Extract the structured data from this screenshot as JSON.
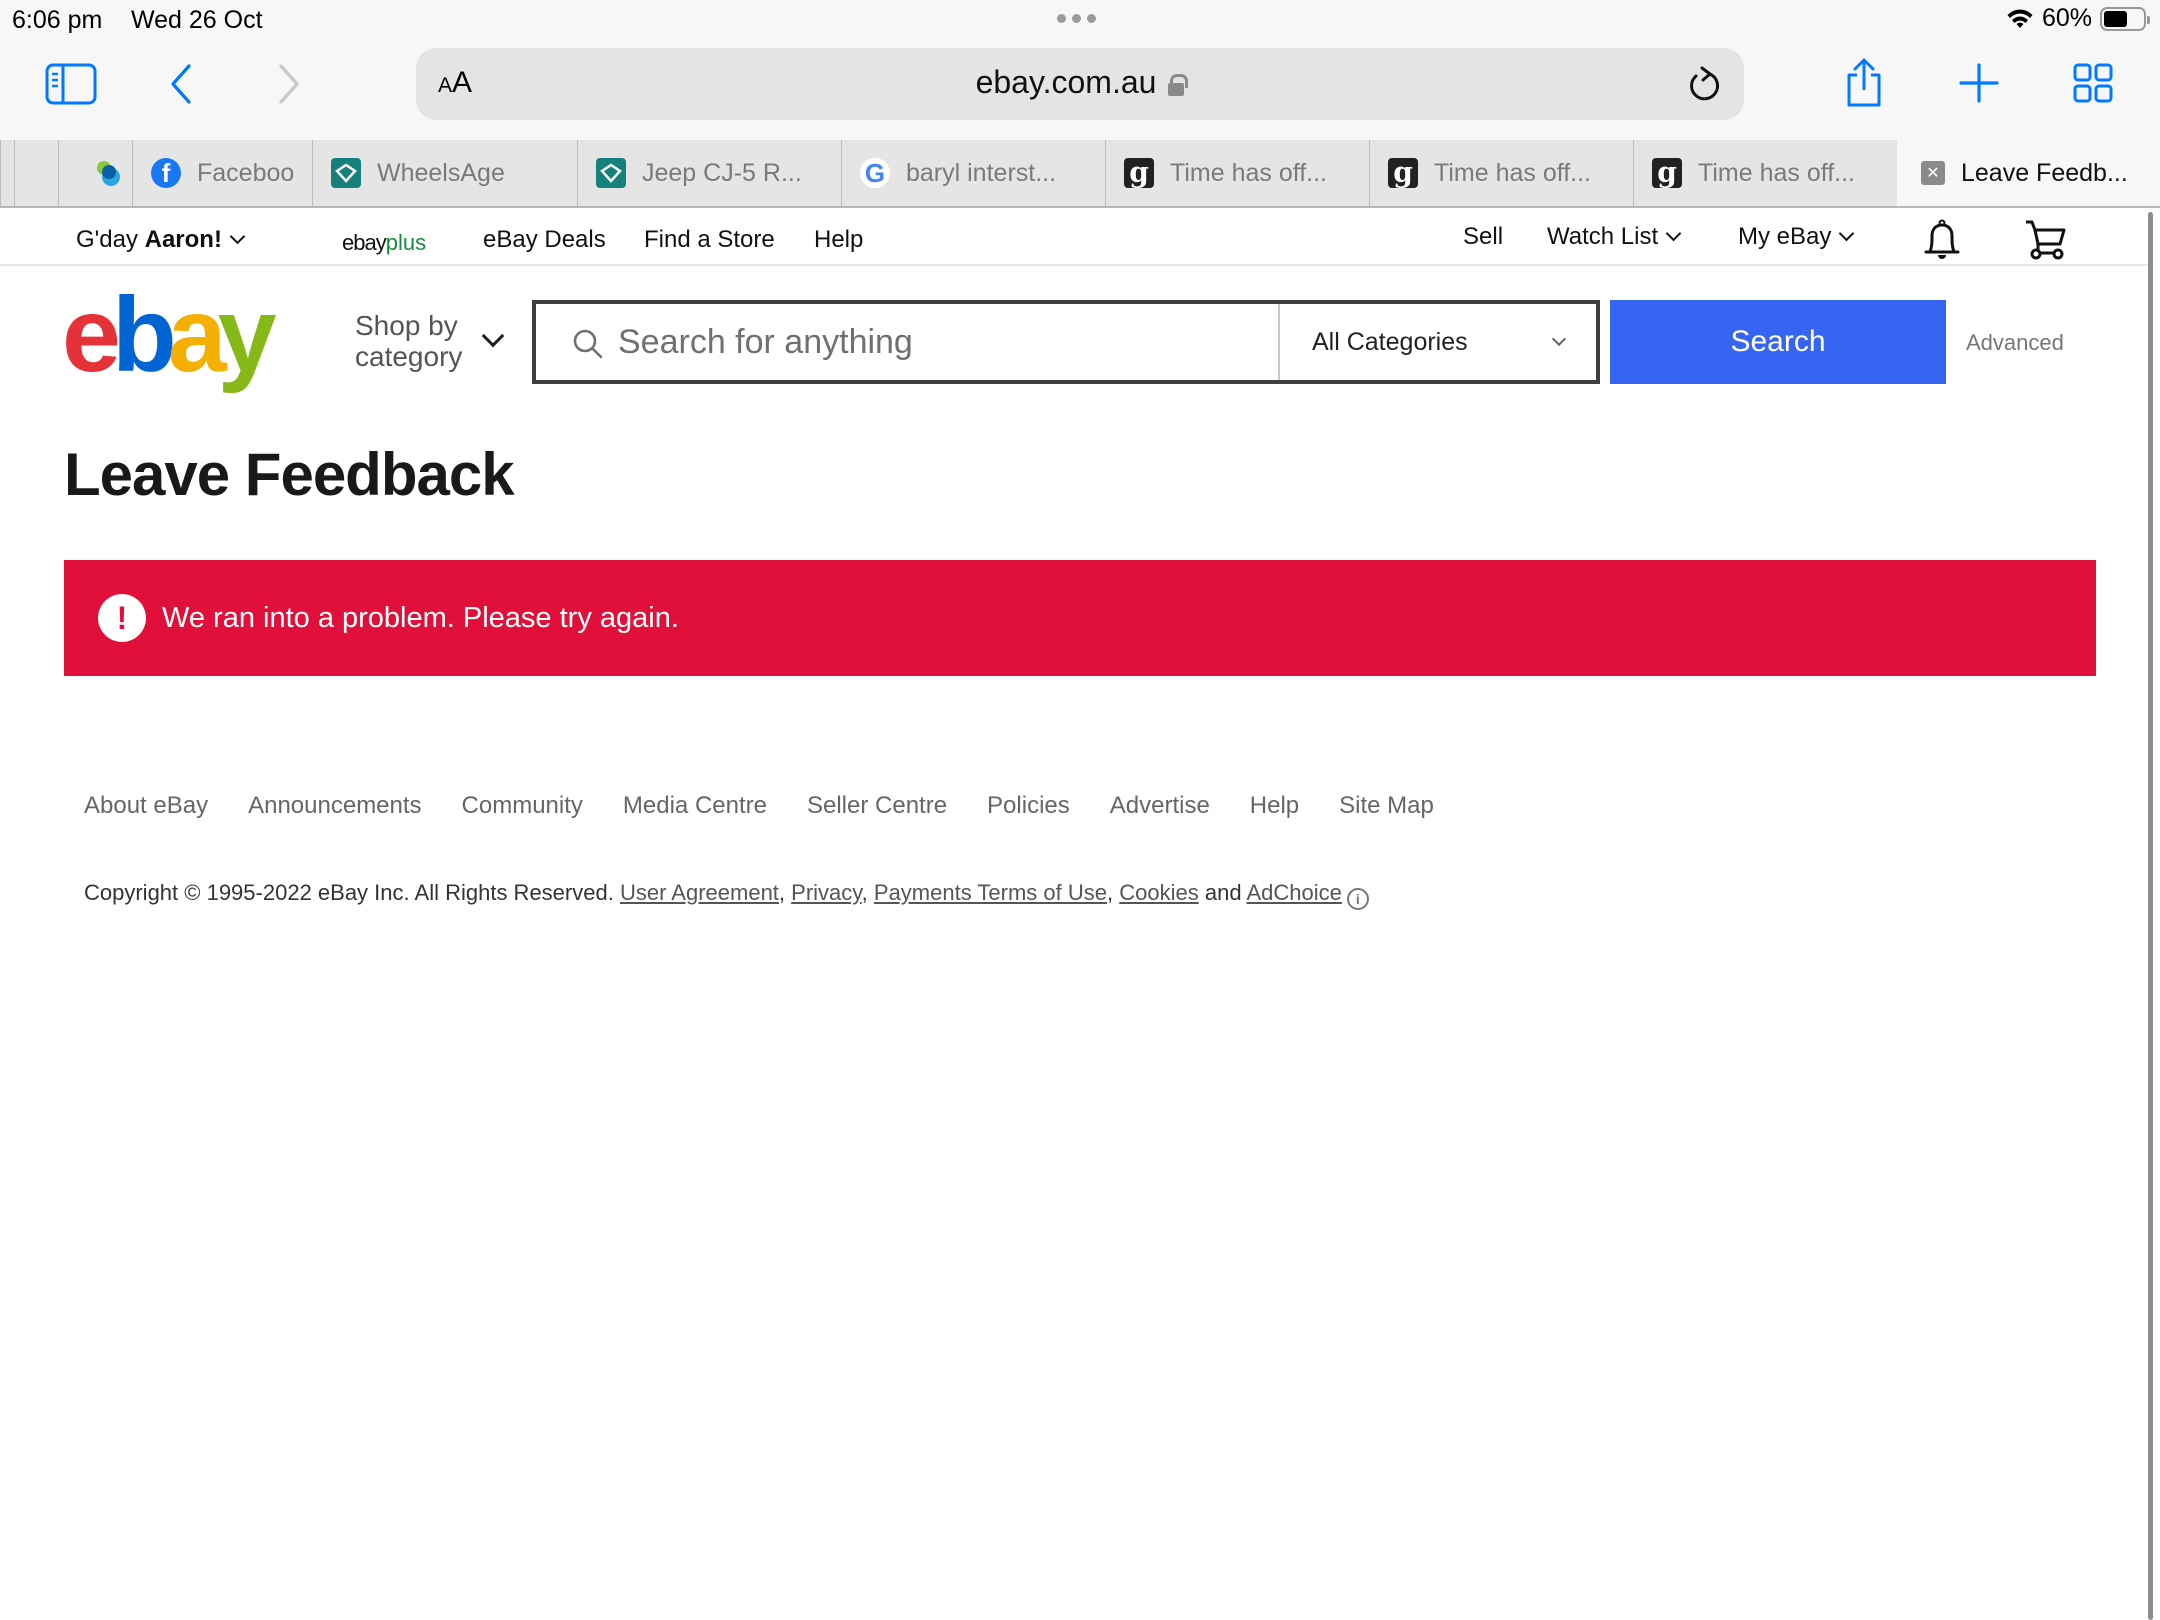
{
  "status_bar": {
    "time": "6:06 pm",
    "date": "Wed 26 Oct",
    "battery_text": "60%",
    "battery_level": 0.6,
    "wifi_icon": "wifi-icon"
  },
  "browser": {
    "sidebar_icon": "sidebar-icon",
    "back_icon": "chevron-left-icon",
    "forward_icon": "chevron-right-icon",
    "reader_label_small": "A",
    "reader_label_large": "A",
    "url": "ebay.com.au",
    "reload_icon": "reload-icon",
    "share_icon": "share-icon",
    "new_tab_icon": "plus-icon",
    "tab_overview_icon": "grid-icon",
    "accent_color": "#007aff"
  },
  "tabs": [
    {
      "label": "",
      "favicon": "blank"
    },
    {
      "label": "",
      "favicon": "circles"
    },
    {
      "label": "Faceboo",
      "favicon": "facebook"
    },
    {
      "label": "WheelsAge",
      "favicon": "wheelsage"
    },
    {
      "label": "Jeep CJ-5 R...",
      "favicon": "wheelsage"
    },
    {
      "label": "baryl interst...",
      "favicon": "google"
    },
    {
      "label": "Time has off...",
      "favicon": "g"
    },
    {
      "label": "Time has off...",
      "favicon": "g"
    },
    {
      "label": "Time has off...",
      "favicon": "g"
    },
    {
      "label": "Leave Feedb...",
      "favicon": "close",
      "active": true
    }
  ],
  "ebay_header": {
    "greeting_prefix": "G'day",
    "user_name": "Aaron!",
    "ebayplus_brand": "ebay",
    "ebayplus_suffix": "plus",
    "links_left": [
      "eBay Deals",
      "Find a Store",
      "Help"
    ],
    "sell": "Sell",
    "watch_list": "Watch List",
    "my_ebay": "My eBay",
    "notifications_icon": "bell-icon",
    "cart_icon": "cart-icon"
  },
  "logo": {
    "e": "e",
    "b": "b",
    "a": "a",
    "y": "y"
  },
  "search": {
    "shop_by_line1": "Shop by",
    "shop_by_line2": "category",
    "placeholder": "Search for anything",
    "value": "",
    "category": "All Categories",
    "button_label": "Search",
    "advanced_label": "Advanced",
    "button_color": "#3665f3"
  },
  "main": {
    "title": "Leave Feedback",
    "alert": {
      "icon": "!",
      "message": "We ran into a problem. Please try again.",
      "color": "#e0103a"
    }
  },
  "footer": {
    "links": [
      "About eBay",
      "Announcements",
      "Community",
      "Media Centre",
      "Seller Centre",
      "Policies",
      "Advertise",
      "Help",
      "Site Map"
    ],
    "copyright": "Copyright © 1995-2022 eBay Inc. All Rights Reserved.",
    "legal_links": [
      "User Agreement",
      "Privacy",
      "Payments Terms of Use",
      "Cookies"
    ],
    "and_text": "and",
    "adchoice": "AdChoice"
  }
}
